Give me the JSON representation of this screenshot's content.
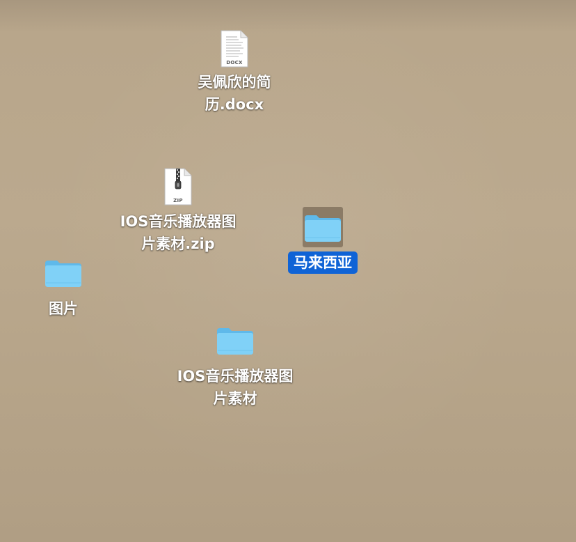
{
  "desktop": {
    "items": [
      {
        "kind": "document",
        "type_badge": "DOCX",
        "lines": [
          "吴佩欣的简",
          "历.docx"
        ],
        "selected": false
      },
      {
        "kind": "archive",
        "type_badge": "ZIP",
        "lines": [
          "IOS音乐播放器图",
          "片素材.zip"
        ],
        "selected": false
      },
      {
        "kind": "folder",
        "lines": [
          "马来西亚"
        ],
        "selected": true
      },
      {
        "kind": "folder",
        "lines": [
          "图片"
        ],
        "selected": false
      },
      {
        "kind": "folder",
        "lines": [
          "IOS音乐播放器图",
          "片素材"
        ],
        "selected": false
      }
    ]
  },
  "colors": {
    "folder_body": "#7dcff5",
    "folder_tab": "#5fb9ea",
    "selection_label": "#0f63d6",
    "selection_icon_bg": "#5c4c3a"
  },
  "icons": {
    "document": "docx-file-icon",
    "archive": "zip-file-icon",
    "folder": "folder-icon"
  }
}
